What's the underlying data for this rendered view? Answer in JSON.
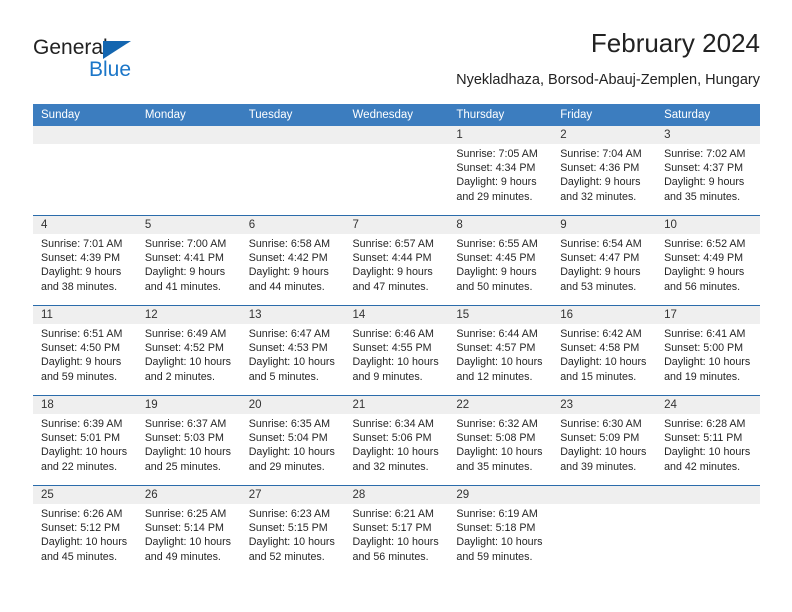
{
  "brand": {
    "name_part1": "General",
    "name_part2": "Blue",
    "accent_color": "#1b76c8",
    "triangle_color": "#1466b0"
  },
  "header": {
    "title": "February 2024",
    "subtitle": "Nyekladhaza, Borsod-Abauj-Zemplen, Hungary"
  },
  "calendar": {
    "header_bg": "#3c7dbf",
    "daynum_bg": "#efefef",
    "week_separator_color": "#2b6cab",
    "weekday_headers": [
      "Sunday",
      "Monday",
      "Tuesday",
      "Wednesday",
      "Thursday",
      "Friday",
      "Saturday"
    ],
    "weeks": [
      [
        {
          "day": "",
          "sunrise": "",
          "sunset": "",
          "daylight_line1": "",
          "daylight_line2": ""
        },
        {
          "day": "",
          "sunrise": "",
          "sunset": "",
          "daylight_line1": "",
          "daylight_line2": ""
        },
        {
          "day": "",
          "sunrise": "",
          "sunset": "",
          "daylight_line1": "",
          "daylight_line2": ""
        },
        {
          "day": "",
          "sunrise": "",
          "sunset": "",
          "daylight_line1": "",
          "daylight_line2": ""
        },
        {
          "day": "1",
          "sunrise": "Sunrise: 7:05 AM",
          "sunset": "Sunset: 4:34 PM",
          "daylight_line1": "Daylight: 9 hours",
          "daylight_line2": "and 29 minutes."
        },
        {
          "day": "2",
          "sunrise": "Sunrise: 7:04 AM",
          "sunset": "Sunset: 4:36 PM",
          "daylight_line1": "Daylight: 9 hours",
          "daylight_line2": "and 32 minutes."
        },
        {
          "day": "3",
          "sunrise": "Sunrise: 7:02 AM",
          "sunset": "Sunset: 4:37 PM",
          "daylight_line1": "Daylight: 9 hours",
          "daylight_line2": "and 35 minutes."
        }
      ],
      [
        {
          "day": "4",
          "sunrise": "Sunrise: 7:01 AM",
          "sunset": "Sunset: 4:39 PM",
          "daylight_line1": "Daylight: 9 hours",
          "daylight_line2": "and 38 minutes."
        },
        {
          "day": "5",
          "sunrise": "Sunrise: 7:00 AM",
          "sunset": "Sunset: 4:41 PM",
          "daylight_line1": "Daylight: 9 hours",
          "daylight_line2": "and 41 minutes."
        },
        {
          "day": "6",
          "sunrise": "Sunrise: 6:58 AM",
          "sunset": "Sunset: 4:42 PM",
          "daylight_line1": "Daylight: 9 hours",
          "daylight_line2": "and 44 minutes."
        },
        {
          "day": "7",
          "sunrise": "Sunrise: 6:57 AM",
          "sunset": "Sunset: 4:44 PM",
          "daylight_line1": "Daylight: 9 hours",
          "daylight_line2": "and 47 minutes."
        },
        {
          "day": "8",
          "sunrise": "Sunrise: 6:55 AM",
          "sunset": "Sunset: 4:45 PM",
          "daylight_line1": "Daylight: 9 hours",
          "daylight_line2": "and 50 minutes."
        },
        {
          "day": "9",
          "sunrise": "Sunrise: 6:54 AM",
          "sunset": "Sunset: 4:47 PM",
          "daylight_line1": "Daylight: 9 hours",
          "daylight_line2": "and 53 minutes."
        },
        {
          "day": "10",
          "sunrise": "Sunrise: 6:52 AM",
          "sunset": "Sunset: 4:49 PM",
          "daylight_line1": "Daylight: 9 hours",
          "daylight_line2": "and 56 minutes."
        }
      ],
      [
        {
          "day": "11",
          "sunrise": "Sunrise: 6:51 AM",
          "sunset": "Sunset: 4:50 PM",
          "daylight_line1": "Daylight: 9 hours",
          "daylight_line2": "and 59 minutes."
        },
        {
          "day": "12",
          "sunrise": "Sunrise: 6:49 AM",
          "sunset": "Sunset: 4:52 PM",
          "daylight_line1": "Daylight: 10 hours",
          "daylight_line2": "and 2 minutes."
        },
        {
          "day": "13",
          "sunrise": "Sunrise: 6:47 AM",
          "sunset": "Sunset: 4:53 PM",
          "daylight_line1": "Daylight: 10 hours",
          "daylight_line2": "and 5 minutes."
        },
        {
          "day": "14",
          "sunrise": "Sunrise: 6:46 AM",
          "sunset": "Sunset: 4:55 PM",
          "daylight_line1": "Daylight: 10 hours",
          "daylight_line2": "and 9 minutes."
        },
        {
          "day": "15",
          "sunrise": "Sunrise: 6:44 AM",
          "sunset": "Sunset: 4:57 PM",
          "daylight_line1": "Daylight: 10 hours",
          "daylight_line2": "and 12 minutes."
        },
        {
          "day": "16",
          "sunrise": "Sunrise: 6:42 AM",
          "sunset": "Sunset: 4:58 PM",
          "daylight_line1": "Daylight: 10 hours",
          "daylight_line2": "and 15 minutes."
        },
        {
          "day": "17",
          "sunrise": "Sunrise: 6:41 AM",
          "sunset": "Sunset: 5:00 PM",
          "daylight_line1": "Daylight: 10 hours",
          "daylight_line2": "and 19 minutes."
        }
      ],
      [
        {
          "day": "18",
          "sunrise": "Sunrise: 6:39 AM",
          "sunset": "Sunset: 5:01 PM",
          "daylight_line1": "Daylight: 10 hours",
          "daylight_line2": "and 22 minutes."
        },
        {
          "day": "19",
          "sunrise": "Sunrise: 6:37 AM",
          "sunset": "Sunset: 5:03 PM",
          "daylight_line1": "Daylight: 10 hours",
          "daylight_line2": "and 25 minutes."
        },
        {
          "day": "20",
          "sunrise": "Sunrise: 6:35 AM",
          "sunset": "Sunset: 5:04 PM",
          "daylight_line1": "Daylight: 10 hours",
          "daylight_line2": "and 29 minutes."
        },
        {
          "day": "21",
          "sunrise": "Sunrise: 6:34 AM",
          "sunset": "Sunset: 5:06 PM",
          "daylight_line1": "Daylight: 10 hours",
          "daylight_line2": "and 32 minutes."
        },
        {
          "day": "22",
          "sunrise": "Sunrise: 6:32 AM",
          "sunset": "Sunset: 5:08 PM",
          "daylight_line1": "Daylight: 10 hours",
          "daylight_line2": "and 35 minutes."
        },
        {
          "day": "23",
          "sunrise": "Sunrise: 6:30 AM",
          "sunset": "Sunset: 5:09 PM",
          "daylight_line1": "Daylight: 10 hours",
          "daylight_line2": "and 39 minutes."
        },
        {
          "day": "24",
          "sunrise": "Sunrise: 6:28 AM",
          "sunset": "Sunset: 5:11 PM",
          "daylight_line1": "Daylight: 10 hours",
          "daylight_line2": "and 42 minutes."
        }
      ],
      [
        {
          "day": "25",
          "sunrise": "Sunrise: 6:26 AM",
          "sunset": "Sunset: 5:12 PM",
          "daylight_line1": "Daylight: 10 hours",
          "daylight_line2": "and 45 minutes."
        },
        {
          "day": "26",
          "sunrise": "Sunrise: 6:25 AM",
          "sunset": "Sunset: 5:14 PM",
          "daylight_line1": "Daylight: 10 hours",
          "daylight_line2": "and 49 minutes."
        },
        {
          "day": "27",
          "sunrise": "Sunrise: 6:23 AM",
          "sunset": "Sunset: 5:15 PM",
          "daylight_line1": "Daylight: 10 hours",
          "daylight_line2": "and 52 minutes."
        },
        {
          "day": "28",
          "sunrise": "Sunrise: 6:21 AM",
          "sunset": "Sunset: 5:17 PM",
          "daylight_line1": "Daylight: 10 hours",
          "daylight_line2": "and 56 minutes."
        },
        {
          "day": "29",
          "sunrise": "Sunrise: 6:19 AM",
          "sunset": "Sunset: 5:18 PM",
          "daylight_line1": "Daylight: 10 hours",
          "daylight_line2": "and 59 minutes."
        },
        {
          "day": "",
          "sunrise": "",
          "sunset": "",
          "daylight_line1": "",
          "daylight_line2": ""
        },
        {
          "day": "",
          "sunrise": "",
          "sunset": "",
          "daylight_line1": "",
          "daylight_line2": ""
        }
      ]
    ]
  }
}
